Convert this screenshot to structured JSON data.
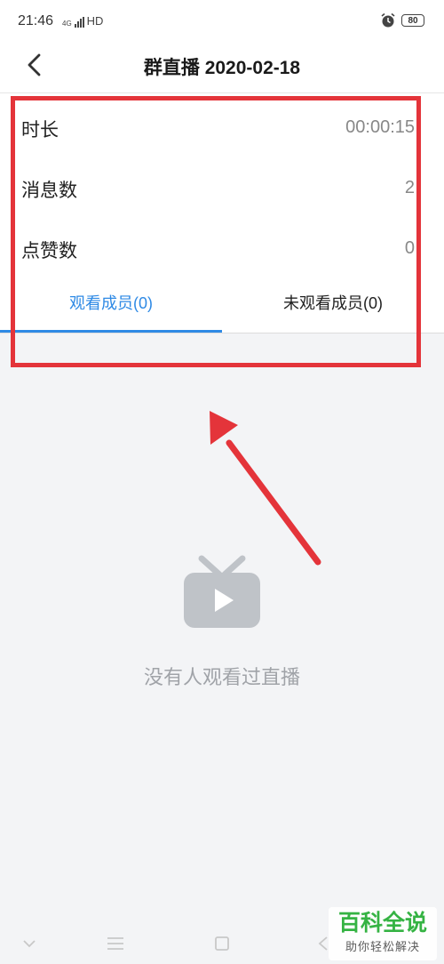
{
  "status_bar": {
    "time": "21:46",
    "network": "4G",
    "hd": "HD",
    "battery": "80"
  },
  "header": {
    "title": "群直播 2020-02-18"
  },
  "stats": [
    {
      "label": "时长",
      "value": "00:00:15"
    },
    {
      "label": "消息数",
      "value": "2"
    },
    {
      "label": "点赞数",
      "value": "0"
    }
  ],
  "tabs": {
    "watched": "观看成员(0)",
    "unwatched": "未观看成员(0)"
  },
  "empty_state": {
    "text": "没有人观看过直播"
  },
  "watermark": {
    "main": "百科全说",
    "sub": "助你轻松解决"
  },
  "colors": {
    "accent": "#2f8ae5",
    "annotation": "#e4343a",
    "watermark": "#2bb03a"
  }
}
